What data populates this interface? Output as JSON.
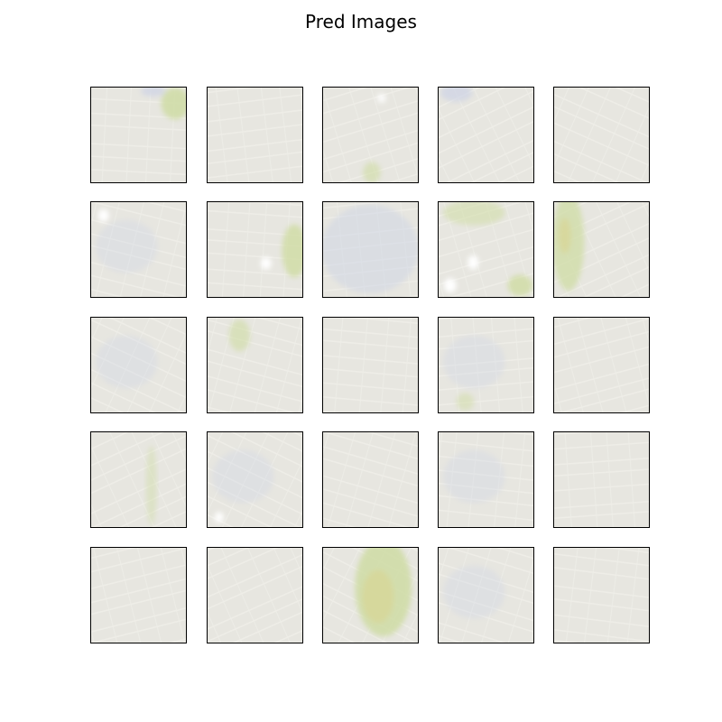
{
  "figure": {
    "title": "Pred Images",
    "rows": 5,
    "cols": 5,
    "colors": {
      "base": "#e7e6e0",
      "street": "#f4f3ee",
      "roof_blue": "#cdd3e6",
      "vegetation": "#cfdca4",
      "vegetation_yellow": "#d9d596",
      "highlight": "#ffffff",
      "border": "#000000"
    }
  },
  "tiles": [
    {
      "name": "pred-image-r1-c1",
      "features": [
        "vegetation-top-right",
        "roof-top"
      ]
    },
    {
      "name": "pred-image-r1-c2",
      "features": []
    },
    {
      "name": "pred-image-r1-c3",
      "features": [
        "white-spot-top",
        "vegetation-bottom"
      ]
    },
    {
      "name": "pred-image-r1-c4",
      "features": [
        "roof-top-left"
      ]
    },
    {
      "name": "pred-image-r1-c5",
      "features": []
    },
    {
      "name": "pred-image-r2-c1",
      "features": [
        "white-spot-top-left",
        "roofs-blue"
      ]
    },
    {
      "name": "pred-image-r2-c2",
      "features": [
        "vegetation-right",
        "white-spot-center"
      ]
    },
    {
      "name": "pred-image-r2-c3",
      "features": [
        "roofs-blue-grid"
      ]
    },
    {
      "name": "pred-image-r2-c4",
      "features": [
        "vegetation-top",
        "white-spots-bottom",
        "vegetation-bottom-right"
      ]
    },
    {
      "name": "pred-image-r2-c5",
      "features": [
        "vegetation-left-strip"
      ]
    },
    {
      "name": "pred-image-r3-c1",
      "features": [
        "roofs-blue"
      ]
    },
    {
      "name": "pred-image-r3-c2",
      "features": [
        "vegetation-top-center"
      ]
    },
    {
      "name": "pred-image-r3-c3",
      "features": []
    },
    {
      "name": "pred-image-r3-c4",
      "features": [
        "roofs-blue",
        "vegetation-bottom-left"
      ]
    },
    {
      "name": "pred-image-r3-c5",
      "features": []
    },
    {
      "name": "pred-image-r4-c1",
      "features": [
        "vegetation-center-strip"
      ]
    },
    {
      "name": "pred-image-r4-c2",
      "features": [
        "roofs-blue",
        "white-spot-bottom-left"
      ]
    },
    {
      "name": "pred-image-r4-c3",
      "features": []
    },
    {
      "name": "pred-image-r4-c4",
      "features": [
        "roofs-blue"
      ]
    },
    {
      "name": "pred-image-r4-c5",
      "features": []
    },
    {
      "name": "pred-image-r5-c1",
      "features": []
    },
    {
      "name": "pred-image-r5-c2",
      "features": []
    },
    {
      "name": "pred-image-r5-c3",
      "features": [
        "vegetation-large-center"
      ]
    },
    {
      "name": "pred-image-r5-c4",
      "features": [
        "roofs-blue"
      ]
    },
    {
      "name": "pred-image-r5-c5",
      "features": []
    }
  ]
}
